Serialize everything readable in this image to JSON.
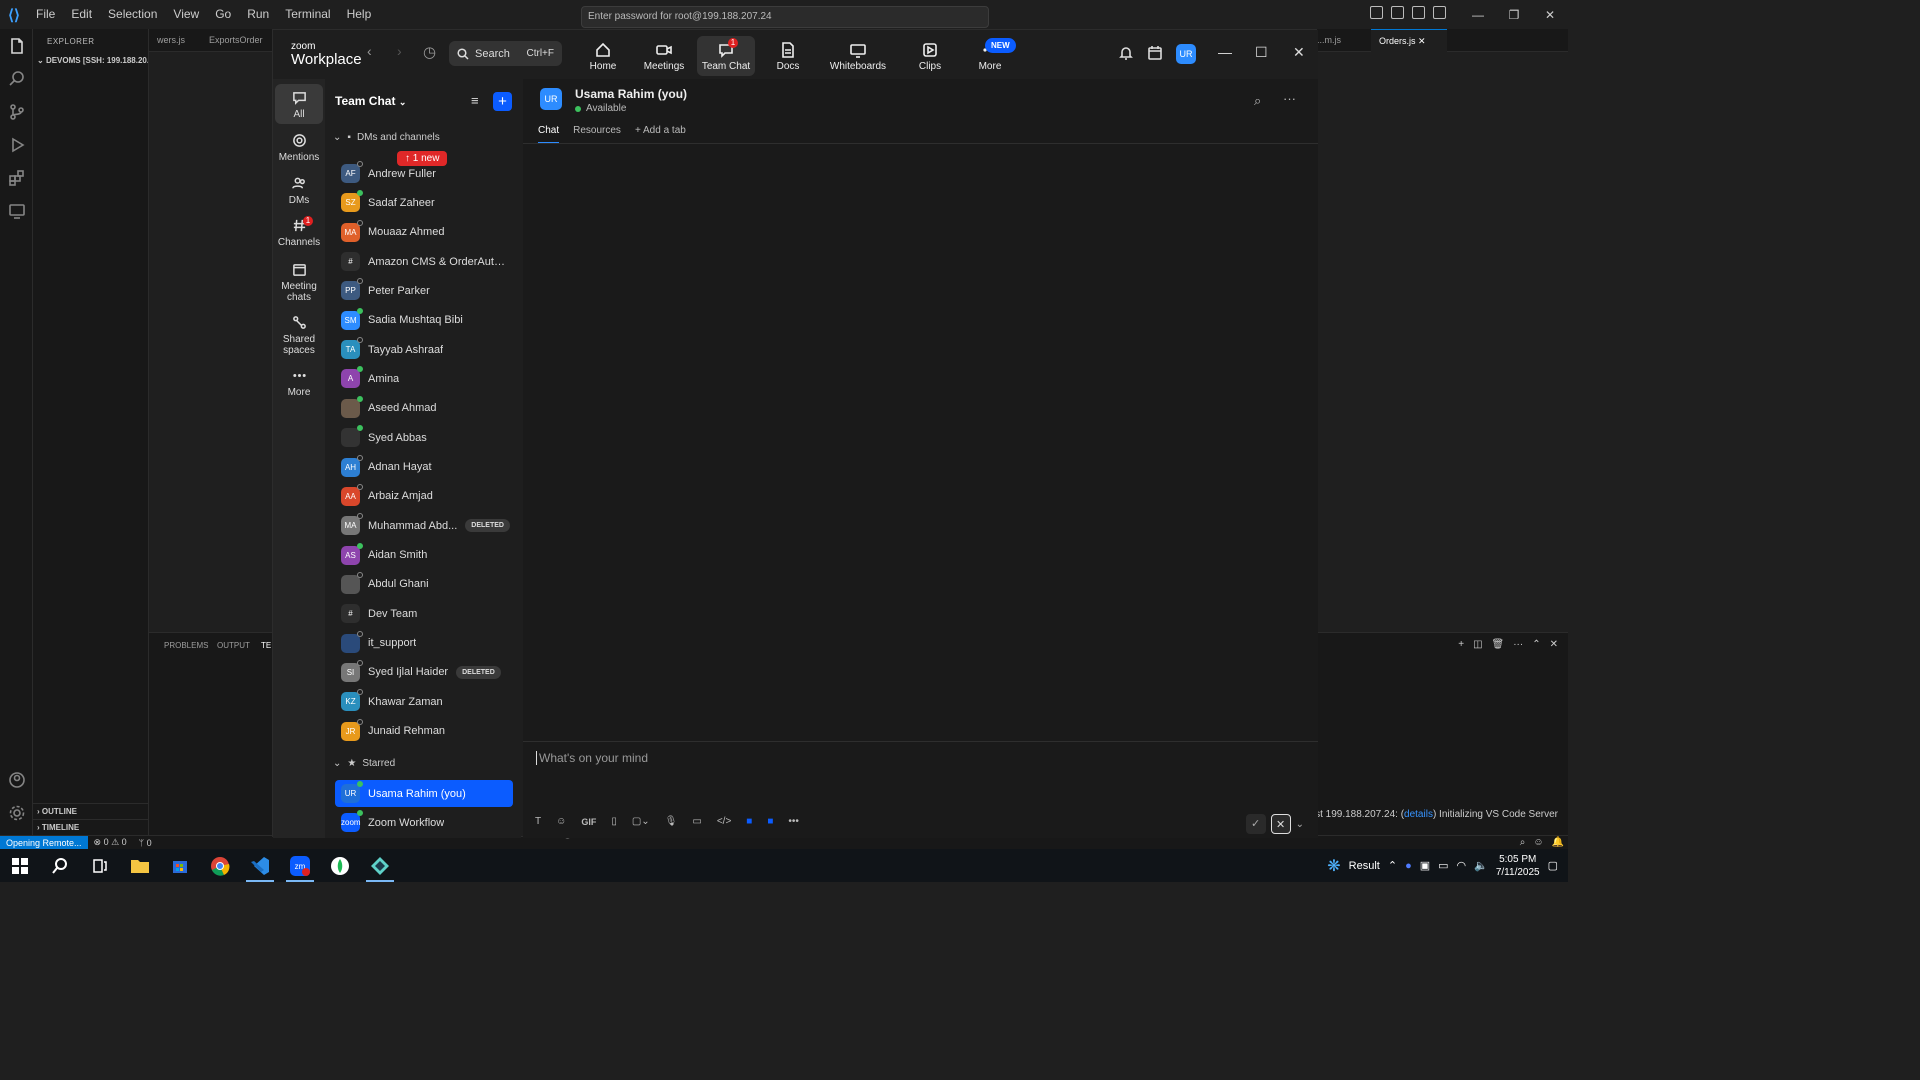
{
  "vscode": {
    "menu": [
      "File",
      "Edit",
      "Selection",
      "View",
      "Go",
      "Run",
      "Terminal",
      "Help"
    ],
    "command_center": "Enter password for root@199.188.207.24",
    "explorer_title": "EXPLORER",
    "explorer_root": "DEVOMS [SSH: 199.188.20...",
    "outline": "OUTLINE",
    "timeline": "TIMELINE",
    "tabs": [
      "wers.js",
      "ExportsOrder",
      "...m.js",
      "Orders.js"
    ],
    "panel_tabs": [
      "PROBLEMS",
      "OUTPUT",
      "TE"
    ],
    "ssh_message_pre": "SSH Host 199.188.207.24: (",
    "ssh_message_link": "details",
    "ssh_message_post": ") Initializing VS Code Server",
    "status_remote": "Opening Remote...",
    "status_problems": "⊗ 0 ⚠ 0",
    "status_ports": "ᛘ 0"
  },
  "zoom": {
    "logo_small": "zoom",
    "logo_big": "Workplace",
    "search_label": "Search",
    "search_shortcut": "Ctrl+F",
    "tabs": [
      {
        "label": "Home",
        "icon": "home-icon"
      },
      {
        "label": "Meetings",
        "icon": "video-icon"
      },
      {
        "label": "Team Chat",
        "icon": "chat-icon",
        "badge": "1"
      },
      {
        "label": "Docs",
        "icon": "doc-icon"
      },
      {
        "label": "Whiteboards",
        "icon": "whiteboard-icon"
      },
      {
        "label": "Clips",
        "icon": "clips-icon"
      },
      {
        "label": "More",
        "icon": "more-icon",
        "pill": "NEW"
      }
    ],
    "profile_initials": "UR",
    "rail": [
      {
        "label": "All"
      },
      {
        "label": "Mentions"
      },
      {
        "label": "DMs"
      },
      {
        "label": "Channels",
        "badge": "1"
      },
      {
        "label": "Meeting chats"
      },
      {
        "label": "Shared spaces"
      },
      {
        "label": "More"
      }
    ],
    "list_title": "Team Chat",
    "dms_section": "DMs and channels",
    "new_pill": "↑ 1 new",
    "contacts": [
      {
        "initials": "AF",
        "name": "Andrew Fuller",
        "color": "#3d5a80",
        "online": false
      },
      {
        "initials": "SZ",
        "name": "Sadaf Zaheer",
        "color": "#e89a1c",
        "online": true
      },
      {
        "initials": "MA",
        "name": "Mouaaz Ahmed",
        "color": "#e0602a",
        "online": false
      },
      {
        "initials": "#",
        "name": "Amazon CMS & OrderAuto...",
        "color": "#2e2e2e",
        "online": null
      },
      {
        "initials": "PP",
        "name": "Peter Parker",
        "color": "#3d5a80",
        "online": false
      },
      {
        "initials": "SM",
        "name": "Sadia Mushtaq Bibi",
        "color": "#2d8cff",
        "online": true
      },
      {
        "initials": "TA",
        "name": "Tayyab Ashraaf",
        "color": "#2a8fbd",
        "online": false
      },
      {
        "initials": "A",
        "name": "Amina",
        "color": "#8e44ad",
        "online": true
      },
      {
        "initials": "",
        "name": "Aseed Ahmad",
        "color": "#6b5a4a",
        "online": true
      },
      {
        "initials": "",
        "name": "Syed Abbas",
        "color": "#333333",
        "online": true
      },
      {
        "initials": "AH",
        "name": "Adnan Hayat",
        "color": "#2d7fd3",
        "online": false
      },
      {
        "initials": "AA",
        "name": "Arbaiz Amjad",
        "color": "#d9472b",
        "online": false
      },
      {
        "initials": "MA",
        "name": "Muhammad Abd...",
        "color": "#777777",
        "online": false,
        "deleted": "DELETED"
      },
      {
        "initials": "AS",
        "name": "Aidan Smith",
        "color": "#8e44ad",
        "online": true
      },
      {
        "initials": "",
        "name": "Abdul Ghani",
        "color": "#555555",
        "online": false
      },
      {
        "initials": "#",
        "name": "Dev Team",
        "color": "#2e2e2e",
        "online": null
      },
      {
        "initials": "",
        "name": "it_support",
        "color": "#2a4a7a",
        "online": false
      },
      {
        "initials": "SI",
        "name": "Syed Ijlal Haider",
        "color": "#777777",
        "online": false,
        "deleted": "DELETED"
      },
      {
        "initials": "KZ",
        "name": "Khawar Zaman",
        "color": "#2a8fbd",
        "online": false
      },
      {
        "initials": "JR",
        "name": "Junaid Rehman",
        "color": "#e89a1c",
        "online": false
      }
    ],
    "starred_section": "Starred",
    "starred": [
      {
        "initials": "UR",
        "name": "Usama Rahim (you)",
        "color": "#1f6fd8",
        "online": true,
        "selected": true
      },
      {
        "initials": "zoom",
        "name": "Zoom Workflow",
        "color": "#0b5cff",
        "online": true
      }
    ],
    "conversation": {
      "initials": "UR",
      "name": "Usama Rahim (you)",
      "status": "Available",
      "tabs": [
        "Chat",
        "Resources",
        "+ Add a tab"
      ],
      "composer_placeholder": "What's on your mind"
    }
  },
  "taskbar": {
    "result_label": "Result",
    "time": "5:05 PM",
    "date": "7/11/2025"
  }
}
